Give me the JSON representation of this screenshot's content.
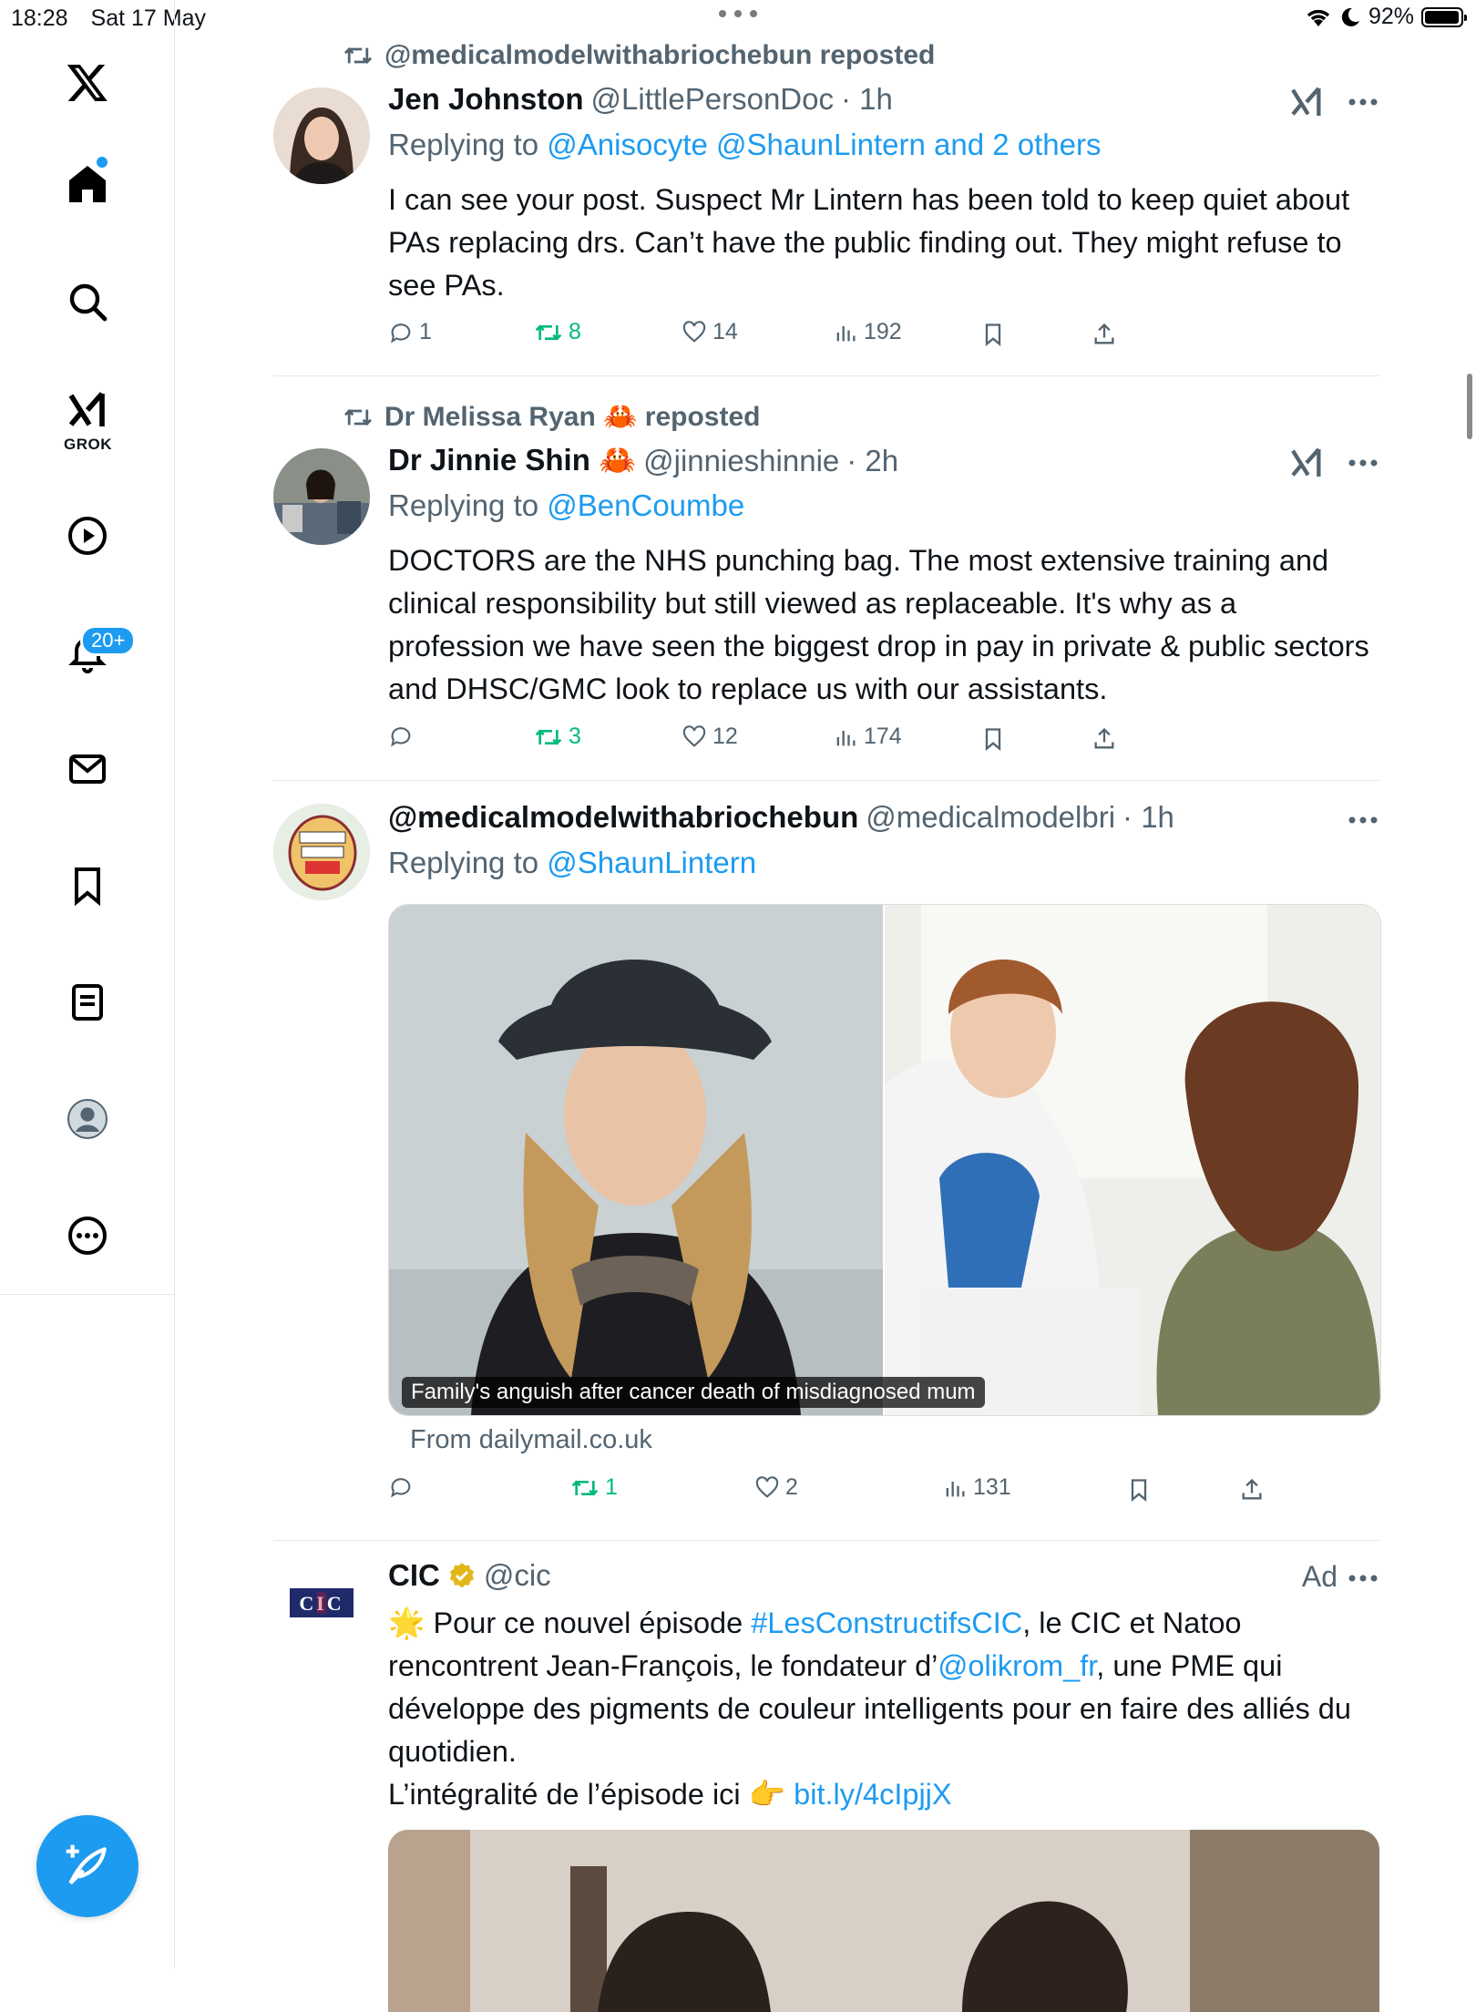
{
  "status_bar": {
    "time": "18:28",
    "date": "Sat 17 May",
    "battery": "92%"
  },
  "sidebar": {
    "grok_label": "GROK",
    "notifications_badge": "20+"
  },
  "tweets": [
    {
      "repost_by": "@medicalmodelwithabriochebun reposted",
      "name": "Jen Johnston",
      "handle": "@LittlePersonDoc",
      "time": "· 1h",
      "replying_prefix": "Replying to",
      "replying_to": "@Anisocyte @ShaunLintern and 2 others",
      "body": "I can see your post. Suspect Mr Lintern has been told to keep quiet about PAs replacing drs. Can’t have the public finding out. They might refuse to see PAs.",
      "replies": "1",
      "reposts": "8",
      "likes": "14",
      "views": "192"
    },
    {
      "repost_by": "Dr Melissa Ryan 🦀 reposted",
      "name": "Dr Jinnie Shin 🦀",
      "handle": "@jinnieshinnie",
      "time": "· 2h",
      "replying_prefix": "Replying to",
      "replying_to": "@BenCoumbe",
      "body": "DOCTORS are the NHS punching bag. The most extensive training and clinical responsibility but still viewed as replaceable. It's why as a profession we have seen the biggest drop in pay in private & public sectors and DHSC/GMC look to replace us with our assistants.",
      "replies": "",
      "reposts": "3",
      "likes": "12",
      "views": "174"
    },
    {
      "name": "@medicalmodelwithabriochebun",
      "handle": "@medicalmodelbri",
      "time": "· 1h",
      "replying_prefix": "Replying to",
      "replying_to": "@ShaunLintern",
      "media_caption": "Family's anguish after cancer death of misdiagnosed mum",
      "from": "From dailymail.co.uk",
      "replies": "",
      "reposts": "1",
      "likes": "2",
      "views": "131"
    },
    {
      "name": "CIC",
      "handle": "@cic",
      "ad_label": "Ad",
      "avatar_text": "CIC",
      "body_star": "🌟",
      "body_p1": " Pour ce nouvel épisode ",
      "hashtag": "#LesConstructifsCIC",
      "body_p2": ", le CIC et Natoo rencontrent Jean-François, le fondateur d’",
      "mention": "@olikrom_fr",
      "body_p3": ", une PME qui développe des pigments de couleur intelligents pour en faire des alliés du quotidien.",
      "body_line2": "L’intégralité de l’épisode ici 👉 ",
      "short_link": "bit.ly/4cIpjjX"
    }
  ],
  "colors": {
    "accent": "#1d9bf0",
    "repost_green": "#00ba7c",
    "muted": "#536471"
  }
}
